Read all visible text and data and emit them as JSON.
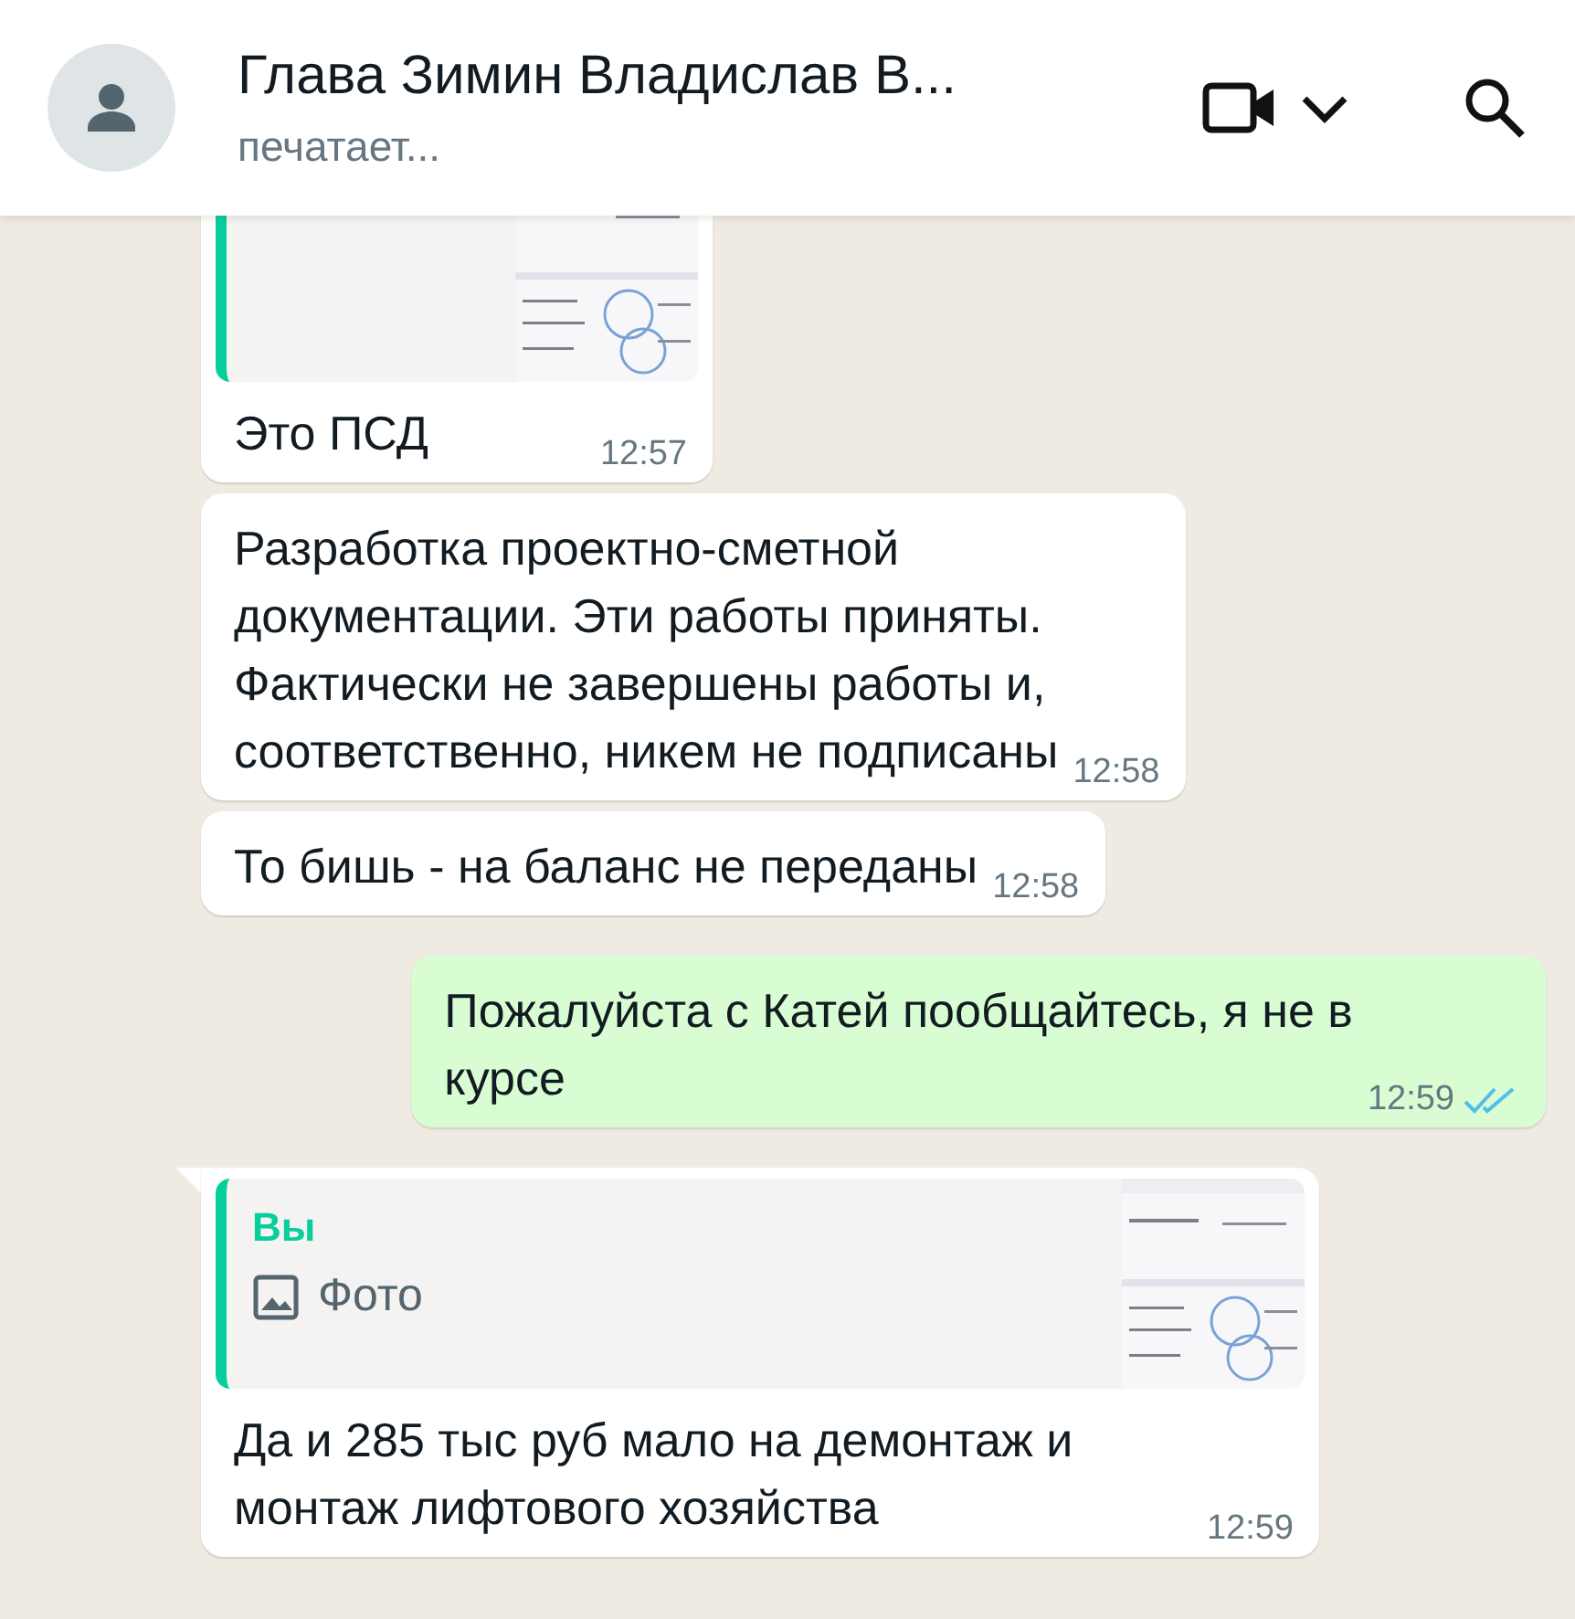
{
  "header": {
    "name": "Глава Зимин Владислав В...",
    "status": "печатает..."
  },
  "messages": [
    {
      "kind": "incoming",
      "quote": {
        "thumbnail": true
      },
      "text": "Это ПСД",
      "time": "12:57",
      "tail": false
    },
    {
      "kind": "incoming",
      "text": "Разработка проектно-сметной\nдокументации. Эти работы приняты.\nФактически не завершены работы и,\nсоответственно, никем не подписаны",
      "time": "12:58",
      "tail": false
    },
    {
      "kind": "incoming",
      "text": "То бишь - на баланс не переданы",
      "time": "12:58",
      "tail": false
    },
    {
      "kind": "outgoing",
      "text": "Пожалуйста с Катей пообщайтесь, я не в\nкурсе",
      "time": "12:59",
      "read": true,
      "tail": false
    },
    {
      "kind": "incoming",
      "quote": {
        "author": "Вы",
        "label": "Фото",
        "thumbnail": true
      },
      "text": "Да и 285 тыс руб мало на демонтаж и\nмонтаж лифтового хозяйства",
      "time": "12:59",
      "tail": true
    }
  ]
}
